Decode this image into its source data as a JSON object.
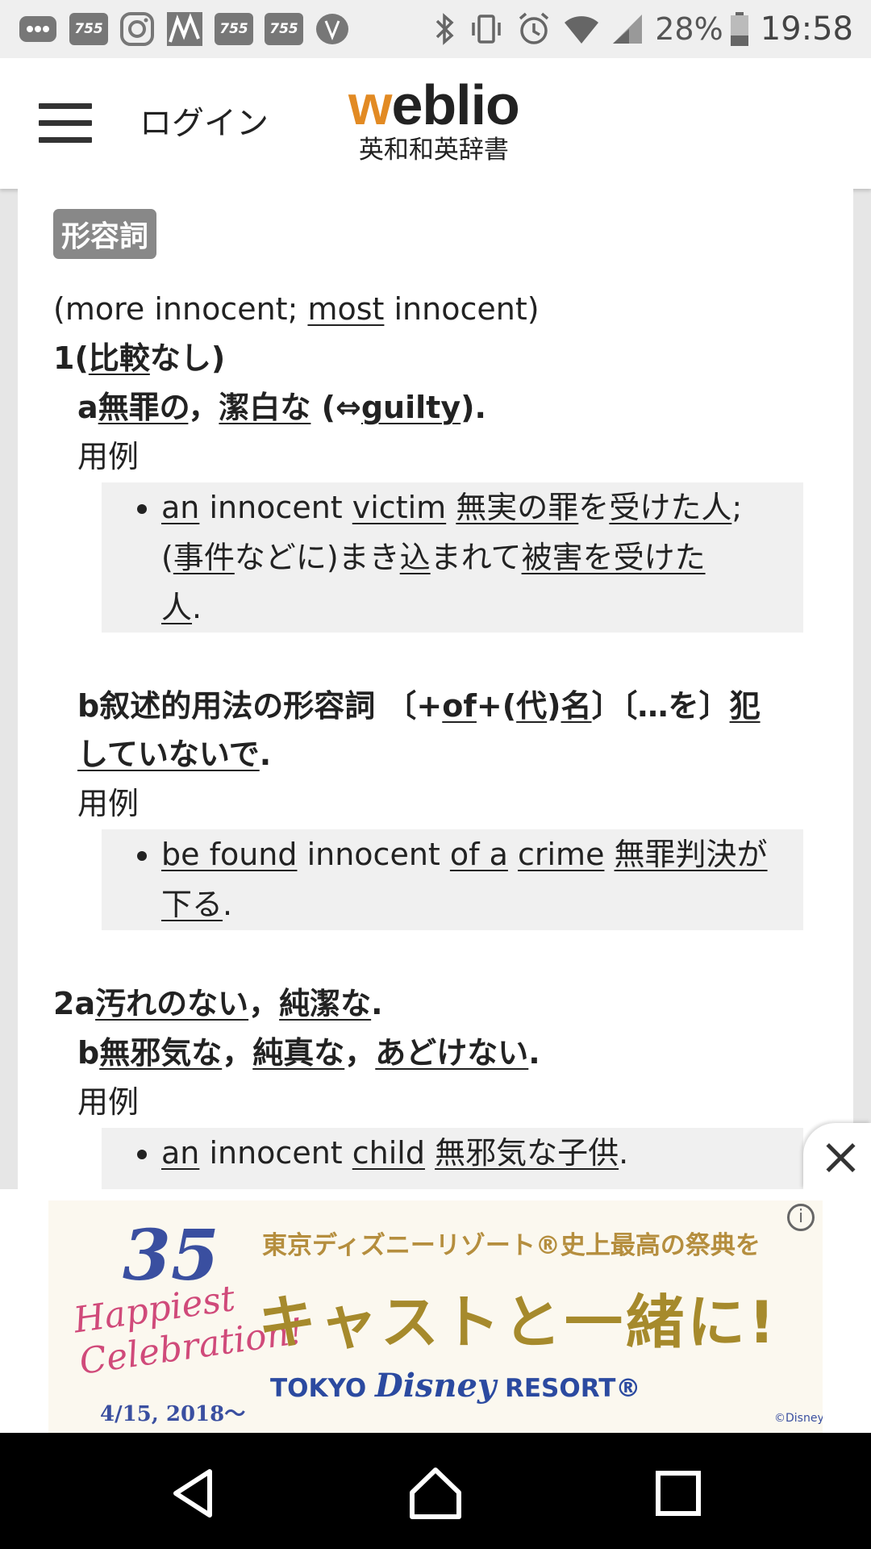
{
  "status_bar": {
    "app_icons": [
      "messages-icon",
      "755-app-icon",
      "instagram-icon",
      "stock-chart-icon",
      "755-app-icon",
      "755-app-icon",
      "shield-app-icon"
    ],
    "app_label_755": "755",
    "system_icons": [
      "bluetooth-icon",
      "vibrate-icon",
      "alarm-icon",
      "wifi-icon",
      "signal-icon",
      "battery-icon"
    ],
    "battery": "28%",
    "time": "19:58"
  },
  "header": {
    "login": "ログイン",
    "brand_w": "w",
    "brand_rest": "eblio",
    "brand_sub": "英和和英辞書"
  },
  "entry": {
    "pos": "形容詞",
    "forms_pre": "(more innocent; ",
    "forms_most": "most",
    "forms_post": " innocent)",
    "s1_num": "1(",
    "s1_kw": "比較",
    "s1_rest": "なし)",
    "s1a_letter": "a",
    "s1a_w1": "無罪の",
    "s1a_sep": "，",
    "s1a_w2": "潔白な",
    "s1a_paren": " (⇔",
    "s1a_g": "guilty",
    "s1a_end": ").",
    "example_label": "用例",
    "ex1": {
      "an": "an",
      "innocent": " innocent ",
      "victim": "victim",
      "jp1": "無実の罪",
      "wo": "を",
      "jp2": "受けた人",
      "semi": ";",
      "open": "(",
      "jp3": "事件",
      "mid1": "などに)まき",
      "jp4": "込",
      "mid2": "まれて",
      "jp5": "被害を受けた",
      "jp6": "人",
      "dot": "."
    },
    "s1b_letter": "b",
    "s1b_text": "叙述的用法の形容詞 〔+",
    "s1b_of": "of",
    "s1b_plus": "+(",
    "s1b_dai": "代",
    "s1b_close": ")",
    "s1b_mei": "名",
    "s1b_bracket": "〕〔…を〕",
    "s1b_han": "犯",
    "s1b_cont": "していないで",
    "s1b_dot": ".",
    "ex2": {
      "be_found": "be found",
      "innocent": " innocent ",
      "of_a": "of a",
      "crime": "crime",
      "jp1": "無罪判決が",
      "jp2": "下る",
      "dot": "."
    },
    "s2a_num": "2a",
    "s2a_w1": "汚れのない",
    "s2a_sep": "，",
    "s2a_w2": "純潔な",
    "s2a_dot": ".",
    "s2b_letter": "b",
    "s2b_w1": "無邪気な",
    "s2b_sep1": "，",
    "s2b_w2": "純真な",
    "s2b_sep2": "，",
    "s2b_w3": "あどけない",
    "s2b_dot": ".",
    "ex3": {
      "an": "an",
      "innocent": " innocent ",
      "child": "child",
      "jp1": "無邪気な子供",
      "dot": "."
    }
  },
  "ad": {
    "number": "35",
    "happiest": "Happiest",
    "celebration": "Celebration!",
    "date": "4/15, 2018～",
    "top_text": "東京ディズニーリゾート®史上最高の祭典を",
    "main_text": "キャストと一緒に!",
    "resort_left": "TOKYO ",
    "resort_disney": "Disney",
    "resort_right": " RESORT®",
    "copyright": "©Disney",
    "info_glyph": "i"
  },
  "colors": {
    "brand_orange": "#e28a23",
    "badge_gray": "#888888",
    "example_bg": "#f0f0f0"
  }
}
